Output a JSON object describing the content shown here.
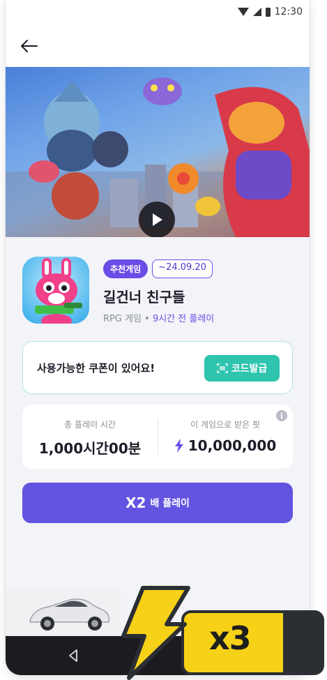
{
  "status_bar": {
    "time": "12:30"
  },
  "game": {
    "tag_recommended": "추천게임",
    "tag_date": "~24.09.20",
    "title": "길건너 친구들",
    "genre": "RPG 게임",
    "separator": "•",
    "last_played": "9시간 전 플레이"
  },
  "coupon": {
    "message": "사용가능한 쿠폰이 있어요!",
    "button_label": "코드발급",
    "button_icon": "barcode-scan-icon"
  },
  "stats": {
    "total_play_label": "총 플레이 시간",
    "total_play_value": "1,000시간00분",
    "points_label": "이 게임으로 받은 핏",
    "points_value": "10,000,000",
    "points_icon": "lightning-icon"
  },
  "play_button": {
    "multiplier": "X2",
    "label": "배 플레이"
  },
  "boost_overlay": {
    "label": "x3"
  },
  "colors": {
    "accent_purple": "#6254e0",
    "coupon_teal": "#2ec4ae",
    "boost_yellow": "#f7d117"
  }
}
